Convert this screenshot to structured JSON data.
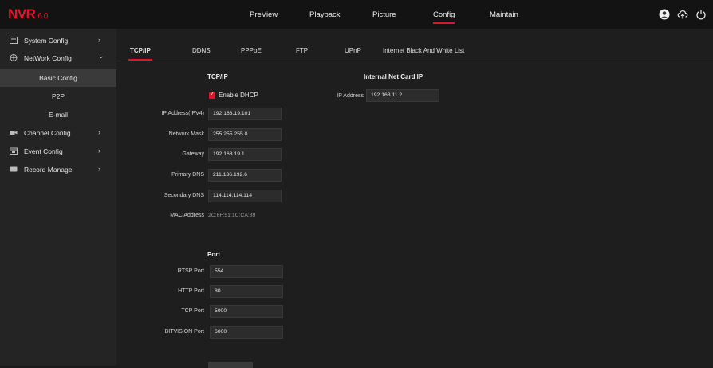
{
  "header": {
    "logo": "NVR",
    "version": "6.0",
    "nav": [
      "PreView",
      "Playback",
      "Picture",
      "Config",
      "Maintain"
    ],
    "active_nav": "Config",
    "icons": [
      "user-icon",
      "cloud-icon",
      "power-icon"
    ]
  },
  "sidebar": {
    "items": [
      {
        "label": "System Config",
        "icon": "system-icon",
        "arrow": "›"
      },
      {
        "label": "NetWork Config",
        "icon": "network-icon",
        "arrow": "⌄"
      },
      {
        "label": "Channel Config",
        "icon": "camera-icon",
        "arrow": "›"
      },
      {
        "label": "Event Config",
        "icon": "calendar-icon",
        "arrow": "›"
      },
      {
        "label": "Record Manage",
        "icon": "record-icon",
        "arrow": "›"
      }
    ],
    "subitems": [
      "Basic Config",
      "P2P",
      "E-mail"
    ],
    "active_sub": "Basic Config"
  },
  "tabs": [
    "TCP/IP",
    "DDNS",
    "PPPoE",
    "FTP",
    "UPnP",
    "Internet Black And White List"
  ],
  "active_tab": "TCP/IP",
  "tcpip": {
    "title": "TCP/IP",
    "dhcp_label": "Enable DHCP",
    "dhcp_checked": true,
    "fields": [
      {
        "label": "IP Address(IPV4)",
        "value": "192.168.19.101"
      },
      {
        "label": "Network Mask",
        "value": "255.255.255.0"
      },
      {
        "label": "Gateway",
        "value": "192.168.19.1"
      },
      {
        "label": "Primary DNS",
        "value": "211.136.192.6"
      },
      {
        "label": "Secondary DNS",
        "value": "114.114.114.114"
      }
    ],
    "mac_label": "MAC Address",
    "mac_value": "2C:6F:51:1C:CA:89"
  },
  "internal": {
    "title": "Internal Net Card IP",
    "ip_label": "IP Address",
    "ip_value": "192.168.11.2"
  },
  "port": {
    "title": "Port",
    "fields": [
      {
        "label": "RTSP Port",
        "value": "554"
      },
      {
        "label": "HTTP Port",
        "value": "80"
      },
      {
        "label": "TCP Port",
        "value": "5000"
      },
      {
        "label": "BITVISION Port",
        "value": "6000"
      }
    ]
  },
  "colors": {
    "accent": "#e0152a",
    "background": "#1c1c1c",
    "sidebar": "#242424"
  }
}
